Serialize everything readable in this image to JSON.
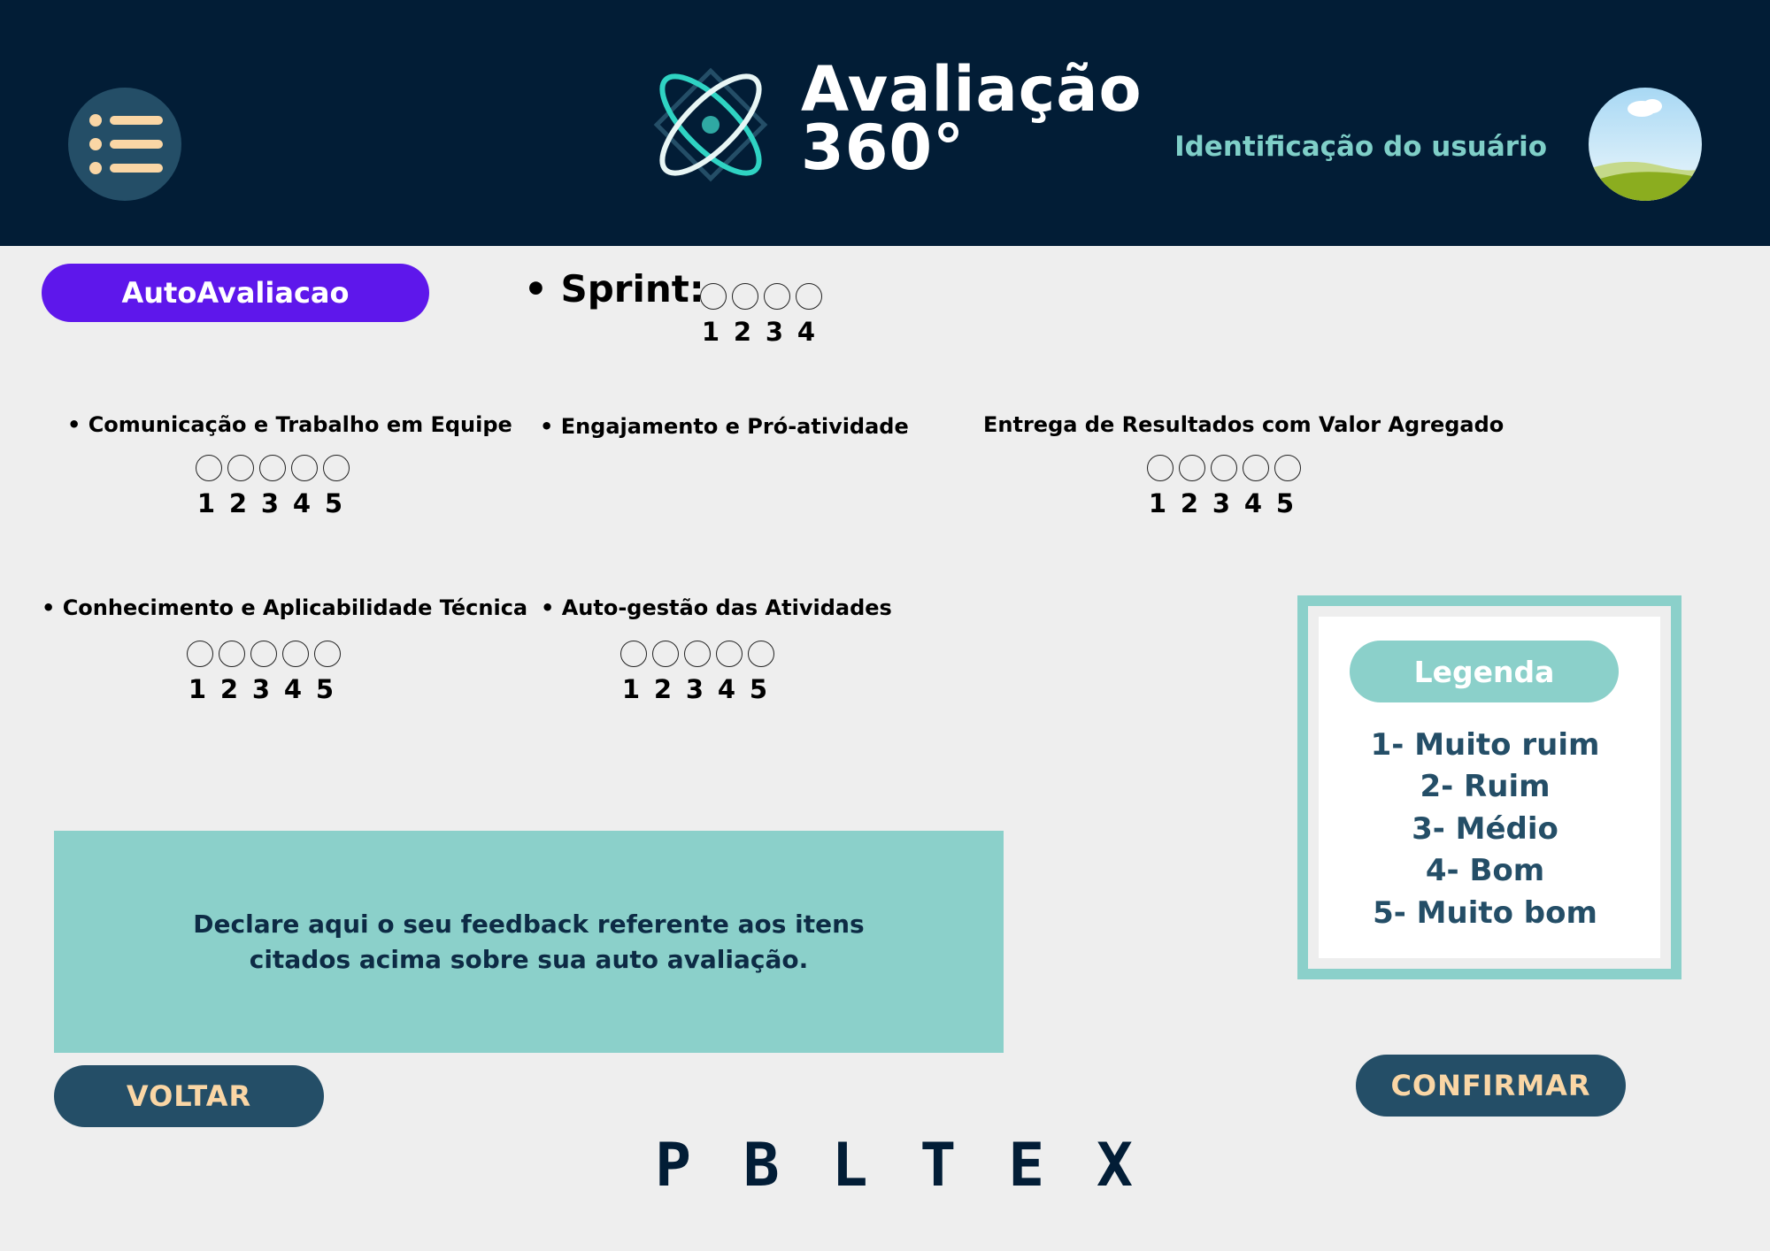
{
  "header": {
    "title_line1": "Avaliação",
    "title_line2": "360°",
    "user_label": "Identificação do usuário",
    "menu_icon": "list-icon",
    "logo_icon": "atom-icon",
    "avatar_icon": "landscape-avatar"
  },
  "tab": {
    "label": "AutoAvaliacao"
  },
  "sprint": {
    "label": "• Sprint:",
    "options": [
      "1",
      "2",
      "3",
      "4"
    ]
  },
  "criteria": [
    {
      "label": "• Comunicação e Trabalho em Equipe",
      "options": [
        "1",
        "2",
        "3",
        "4",
        "5"
      ]
    },
    {
      "label": "• Engajamento e Pró-atividade"
    },
    {
      "label": "Entrega de Resultados com Valor Agregado",
      "options": [
        "1",
        "2",
        "3",
        "4",
        "5"
      ]
    },
    {
      "label": "• Conhecimento e Aplicabilidade Técnica",
      "options": [
        "1",
        "2",
        "3",
        "4",
        "5"
      ]
    },
    {
      "label": "• Auto-gestão das Atividades",
      "options": [
        "1",
        "2",
        "3",
        "4",
        "5"
      ]
    }
  ],
  "feedback": {
    "line1": "Declare aqui o seu feedback referente aos itens",
    "line2": "citados acima sobre sua auto avaliação."
  },
  "legend": {
    "title": "Legenda",
    "items": [
      "1- Muito ruim",
      "2- Ruim",
      "3- Médio",
      "4- Bom",
      "5- Muito bom"
    ]
  },
  "buttons": {
    "back": "VOLTAR",
    "confirm": "CONFIRMAR"
  },
  "brand": {
    "letters": [
      "P",
      "B",
      "L",
      "T",
      "E",
      "X"
    ]
  },
  "colors": {
    "header_bg": "#021d36",
    "accent_purple": "#5e17eb",
    "teal": "#8bd0ca",
    "button_bg": "#244e67",
    "button_text": "#fad6a5"
  }
}
